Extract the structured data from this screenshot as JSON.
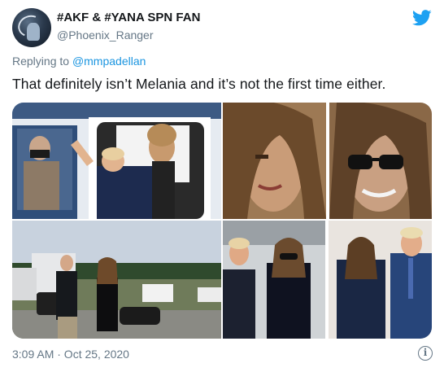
{
  "author": {
    "display_name": "#AKF & #YANA SPN FAN",
    "handle": "@Phoenix_Ranger",
    "avatar_icon": "profile-avatar"
  },
  "reply": {
    "prefix": "Replying to ",
    "mention": "@mmpadellan"
  },
  "tweet": {
    "text": "That definitely isn’t Melania and it’s not the first time either."
  },
  "media": {
    "count": 4,
    "photos": [
      {
        "subject": "people waving at aircraft door"
      },
      {
        "subject": "two face close-ups"
      },
      {
        "subject": "two people by vehicles outdoors"
      },
      {
        "subject": "two side-by-side photos of people"
      }
    ]
  },
  "footer": {
    "timestamp": "3:09 AM · Oct 25, 2020",
    "info_icon": "info-icon"
  },
  "colors": {
    "brand": "#1da1f2",
    "link": "#1b95e0",
    "secondary_text": "#657786",
    "primary_text": "#14171a"
  }
}
